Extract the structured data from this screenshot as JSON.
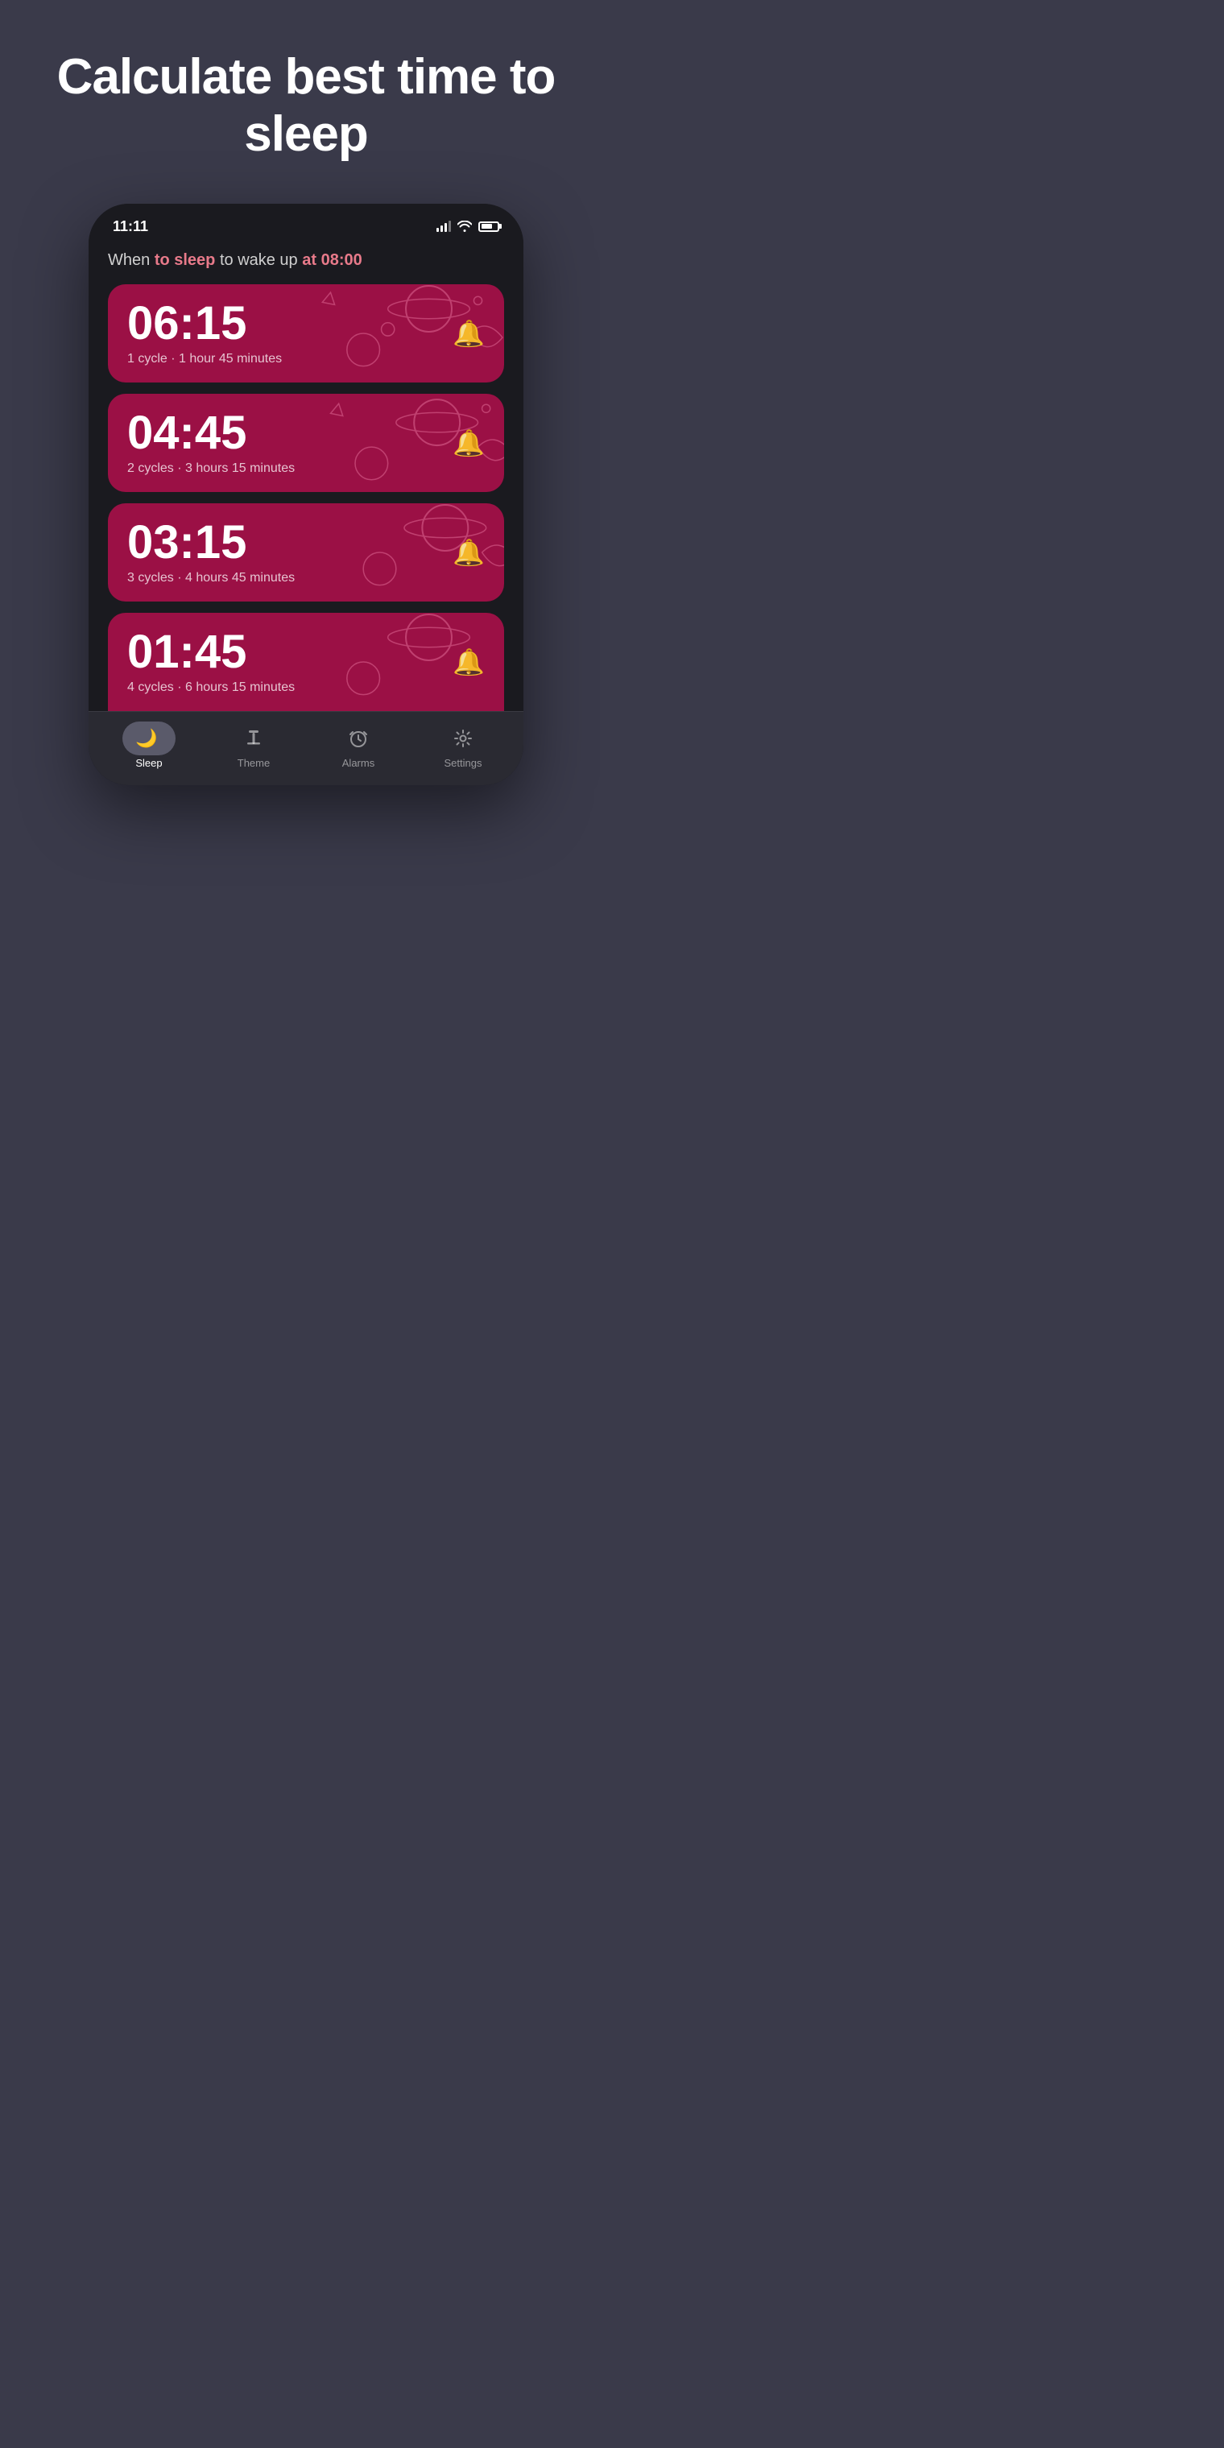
{
  "hero": {
    "title": "Calculate best time to sleep"
  },
  "status_bar": {
    "time": "11:11"
  },
  "phone": {
    "wake_text_prefix": "When ",
    "wake_highlight1": "to sleep",
    "wake_text_middle": " to wake up ",
    "wake_highlight2": "at 08:00",
    "cards": [
      {
        "time": "06:15",
        "info": "1 cycle · 1 hour 45 minutes"
      },
      {
        "time": "04:45",
        "info": "2 cycles · 3 hours 15 minutes"
      },
      {
        "time": "03:15",
        "info": "3 cycles · 4 hours 45 minutes"
      },
      {
        "time": "01:45",
        "info": "4 cycles · 6 hours 15 minutes"
      }
    ]
  },
  "nav": {
    "items": [
      {
        "id": "sleep",
        "label": "Sleep",
        "active": true
      },
      {
        "id": "theme",
        "label": "Theme",
        "active": false
      },
      {
        "id": "alarms",
        "label": "Alarms",
        "active": false
      },
      {
        "id": "settings",
        "label": "Settings",
        "active": false
      }
    ]
  },
  "colors": {
    "card_bg": "#9b1045",
    "body_bg": "#3a3a4a",
    "phone_bg": "#1a1a1f"
  }
}
